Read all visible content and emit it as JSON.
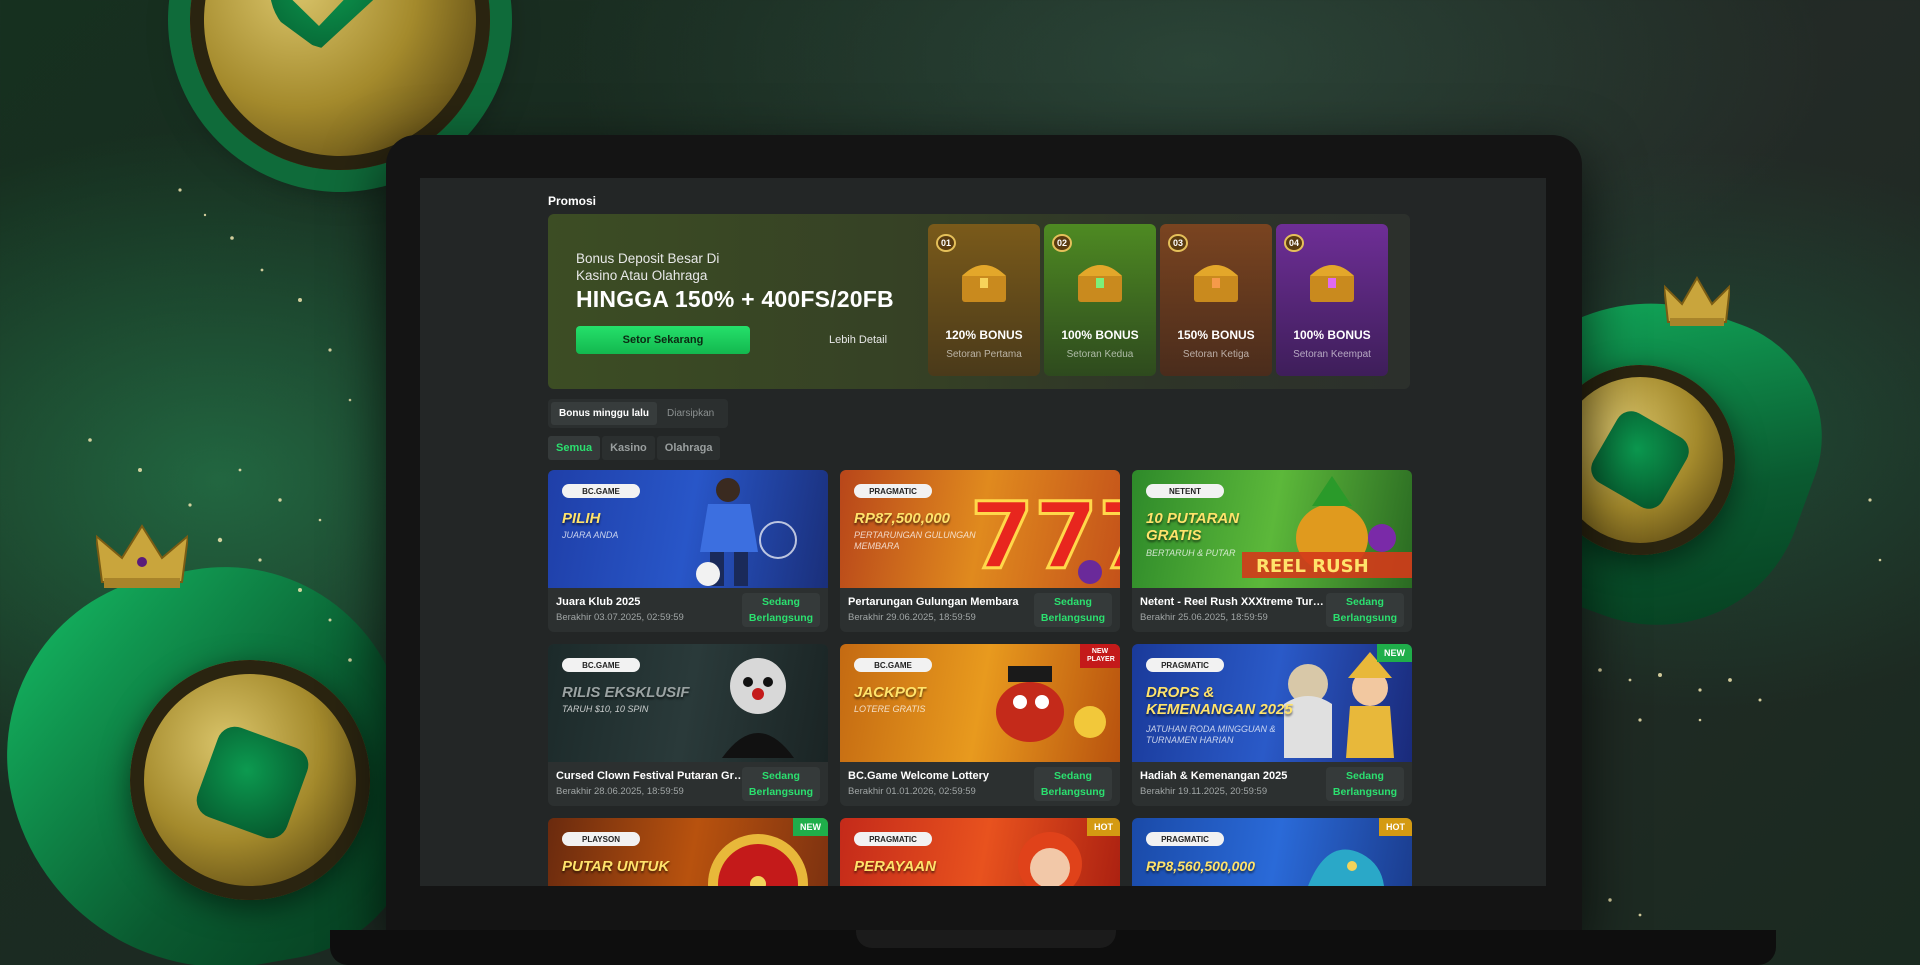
{
  "section_title": "Promosi",
  "banner": {
    "subtitle_line1": "Bonus Deposit Besar Di",
    "subtitle_line2": "Kasino Atau Olahraga",
    "headline": "HINGGA 150% + 400FS/20FB",
    "cta_label": "Setor Sekarang",
    "details_label": "Lebih Detail",
    "tiers": [
      {
        "num": "01",
        "pct": "120% BONUS",
        "caption": "Setoran Pertama",
        "color": "#6b5018"
      },
      {
        "num": "02",
        "pct": "100% BONUS",
        "caption": "Setoran Kedua",
        "color": "#3f6a1e"
      },
      {
        "num": "03",
        "pct": "150% BONUS",
        "caption": "Setoran Ketiga",
        "color": "#6a3a1c"
      },
      {
        "num": "04",
        "pct": "100% BONUS",
        "caption": "Setoran Keempat",
        "color": "#5a2a78"
      }
    ]
  },
  "tabs": [
    "Bonus minggu lalu",
    "Diarsipkan"
  ],
  "filters": [
    "Semua",
    "Kasino",
    "Olahraga"
  ],
  "status_line1": "Sedang",
  "status_line2": "Berlangsung",
  "cards": [
    {
      "brand": "BC.GAME",
      "title": "PILIH",
      "subtitle": "JUARA ANDA",
      "name": "Juara Klub 2025",
      "ends": "Berakhir 03.07.2025, 02:59:59",
      "badge": ""
    },
    {
      "brand": "PRAGMATIC",
      "title": "RP87,500,000",
      "subtitle": "PERTARUNGAN GULUNGAN MEMBARA",
      "name": "Pertarungan Gulungan Membara",
      "ends": "Berakhir 29.06.2025, 18:59:59",
      "badge": ""
    },
    {
      "brand": "NETENT",
      "title": "10 PUTARAN GRATIS",
      "subtitle": "BERTARUH & PUTAR",
      "name": "Netent - Reel Rush XXXtreme Turnamen",
      "ends": "Berakhir 25.06.2025, 18:59:59",
      "badge": ""
    },
    {
      "brand": "BC.GAME",
      "title": "RILIS EKSKLUSIF",
      "subtitle": "TARUH $10, 10 SPIN",
      "name": "Cursed Clown Festival Putaran Gratis",
      "ends": "Berakhir 28.06.2025, 18:59:59",
      "badge": ""
    },
    {
      "brand": "BC.GAME",
      "title": "JACKPOT",
      "subtitle": "LOTERE GRATIS",
      "name": "BC.Game Welcome Lottery",
      "ends": "Berakhir 01.01.2026, 02:59:59",
      "badge": "NEW PLAYER"
    },
    {
      "brand": "PRAGMATIC",
      "title": "DROPS & KEMENANGAN 2025",
      "subtitle": "JATUHAN RODA MINGGUAN & TURNAMEN HARIAN",
      "name": "Hadiah & Kemenangan 2025",
      "ends": "Berakhir 19.11.2025, 20:59:59",
      "badge": "NEW"
    },
    {
      "brand": "PLAYSON",
      "title": "PUTAR UNTUK",
      "subtitle": "",
      "name": "",
      "ends": "",
      "badge": "NEW"
    },
    {
      "brand": "PRAGMATIC",
      "title": "PERAYAAN",
      "subtitle": "",
      "name": "",
      "ends": "",
      "badge": "HOT"
    },
    {
      "brand": "PRAGMATIC",
      "title": "RP8,560,500,000",
      "subtitle": "",
      "name": "",
      "ends": "",
      "badge": "HOT"
    }
  ],
  "colors": {
    "accent": "#2be06f",
    "screen_bg": "#232626",
    "card_bg": "#2c3030"
  }
}
